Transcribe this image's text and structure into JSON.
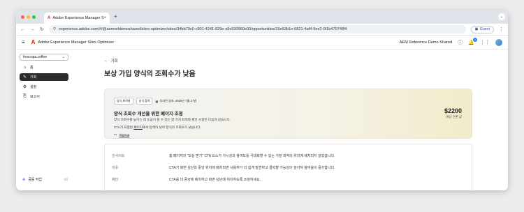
{
  "browser": {
    "tab_title": "Adobe Experience Manager S",
    "tab_close": "×",
    "new_tab": "+",
    "url": "experience.adobe.com/#/@aemrefdemoshared/sites-optimizer/sites/34bb79c0-c901-4241-929e-a9c930560e03/opportunities/15e53b1e-6821-4af4-9ee2-0f1b479748f4",
    "profile": "Guest",
    "colors": {
      "close": "#ff5f57",
      "minimize": "#febc2e",
      "maximize": "#28c840"
    }
  },
  "app": {
    "title": "Adobe Experience Manager Sites Optimizer",
    "org": "AEM Reference Demo Shared",
    "notification_count": "1"
  },
  "sidebar": {
    "site_select": "frescopa.coffee",
    "items": [
      {
        "label": "홈",
        "icon": "home-icon",
        "glyph": "⌂"
      },
      {
        "label": "기회",
        "icon": "opportunities-icon",
        "glyph": "✎"
      },
      {
        "label": "설정",
        "icon": "gear-icon",
        "glyph": "⚙"
      },
      {
        "label": "보고서",
        "icon": "reports-icon",
        "glyph": "⎘"
      }
    ],
    "collab_label": "공동 작업"
  },
  "main": {
    "back_label": "기회",
    "page_title": "보상 가입 양식의 조회수가 낮음",
    "card": {
      "tags": [
        "양식 최적화",
        "양식 참여"
      ],
      "date": "추가된 일자: 2025년 7월 17일",
      "title": "양식 조회수 개선을 위한 페이지 조정",
      "description": "양식 조회수를 높이는 데 도움이 될 수 있는 몇 가지 최적화 제안 사항은 다음과 같습니다.",
      "line_before": "CTA가 포함된 ",
      "line_link": "페이지",
      "line_after": "에서 탐색이 낮아 양식의 조회수가 낮습니다.",
      "link_path": "/signup",
      "amount": "$2200",
      "amount_label": "예상 전환 값"
    },
    "details": [
      {
        "key": "인사이트",
        "value": "홈 페이지의 \"보상 받기\" CTA 요소가 가시성과 참여도를 극대화할 수 있는 가장 최적의 위치에 배치되지 않았습니다."
      },
      {
        "key": "이유",
        "value": "CTA가 화면 상단과 중앙 위치에 배치되면 사용자가 더 쉽게 발견하고 클릭할 가능성이 높아져 참여율이 증가합니다."
      },
      {
        "key": "제안",
        "value": "CTA를 더 중앙에 배치하고 화면 상단에 위치하도록 조정하세요."
      }
    ]
  }
}
